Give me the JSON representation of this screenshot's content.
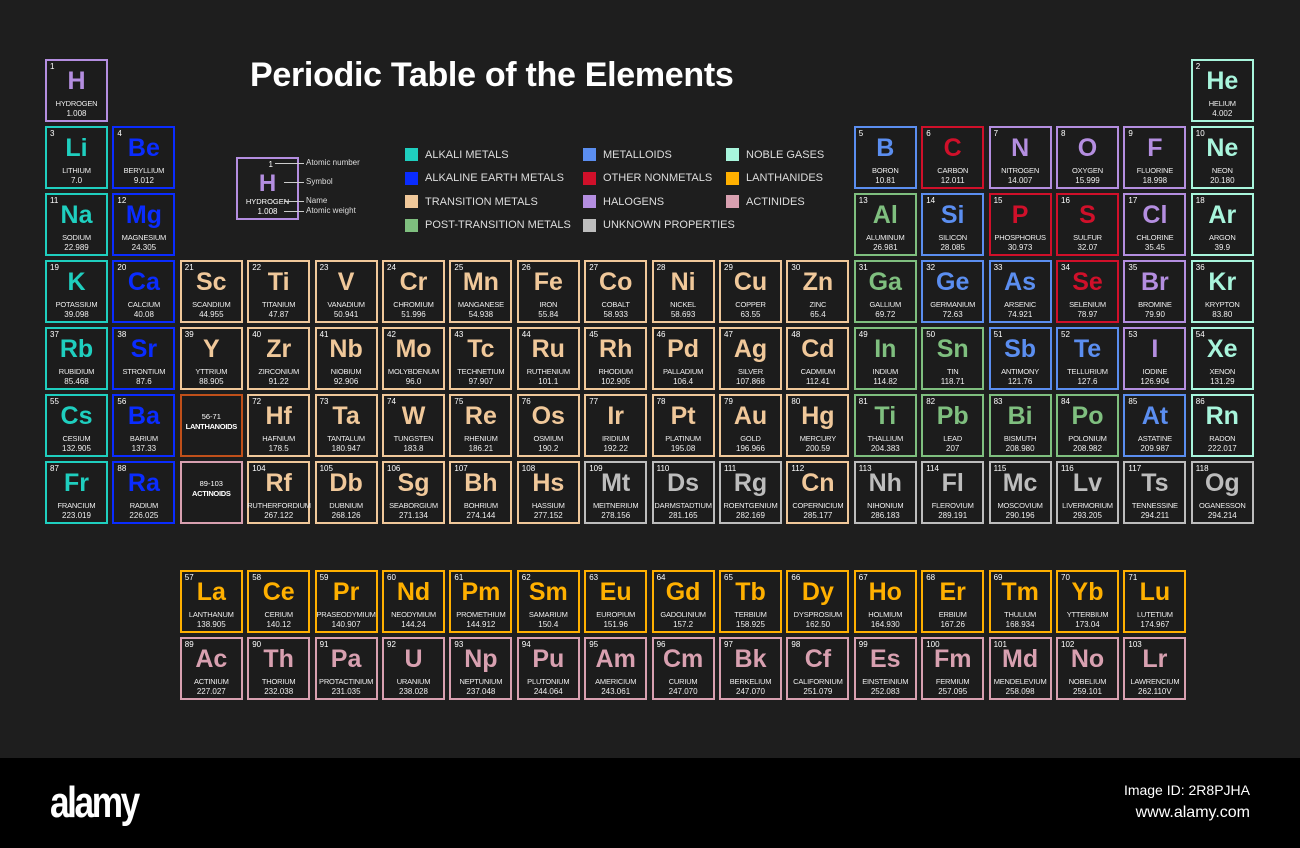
{
  "title": "Periodic Table of the Elements",
  "key": {
    "number": "1",
    "symbol": "H",
    "name": "HYDROGEN",
    "weight": "1.008",
    "labels": {
      "number": "Atomic number",
      "symbol": "Symbol",
      "name": "Name",
      "weight": "Atomic weight"
    }
  },
  "categories": {
    "alkali": {
      "label": "ALKALI METALS",
      "color": "#1fcfbf"
    },
    "alkaline": {
      "label": "ALKALINE EARTH METALS",
      "color": "#0a2cff"
    },
    "transition": {
      "label": "TRANSITION METALS",
      "color": "#f0c89a"
    },
    "post": {
      "label": "POST-TRANSITION METALS",
      "color": "#7fbf7f"
    },
    "metalloid": {
      "label": "METALLOIDS",
      "color": "#5b8ef0"
    },
    "nonmetal": {
      "label": "OTHER NONMETALS",
      "color": "#d0102a"
    },
    "halogen": {
      "label": "HALOGENS",
      "color": "#b48ee0"
    },
    "unknown": {
      "label": "UNKNOWN PROPERTIES",
      "color": "#bdbdbd"
    },
    "noble": {
      "label": "NOBLE GASES",
      "color": "#a8f5dc"
    },
    "lanthanide": {
      "label": "LANTHANIDES",
      "color": "#ffb000"
    },
    "actinide": {
      "label": "ACTINIDES",
      "color": "#d8a0b0"
    }
  },
  "legend_order": [
    "alkali",
    "alkaline",
    "transition",
    "post",
    "metalloid",
    "nonmetal",
    "halogen",
    "unknown",
    "noble",
    "lanthanide",
    "actinide"
  ],
  "placeholders": [
    {
      "range": "56-71",
      "label": "LANTHANOIDS",
      "color": "#c0501a"
    },
    {
      "range": "89-103",
      "label": "ACTINOIDS",
      "color": "#d8a0b0"
    }
  ],
  "elements": [
    [
      1,
      "H",
      "HYDROGEN",
      "1.008",
      "halogen"
    ],
    [
      2,
      "He",
      "HELIUM",
      "4.002",
      "noble"
    ],
    [
      3,
      "Li",
      "LITHIUM",
      "7.0",
      "alkali"
    ],
    [
      4,
      "Be",
      "BERYLLIUM",
      "9.012",
      "alkaline"
    ],
    [
      5,
      "B",
      "BORON",
      "10.81",
      "metalloid"
    ],
    [
      6,
      "C",
      "CARBON",
      "12.011",
      "nonmetal"
    ],
    [
      7,
      "N",
      "NITROGEN",
      "14.007",
      "halogen"
    ],
    [
      8,
      "O",
      "OXYGEN",
      "15.999",
      "halogen"
    ],
    [
      9,
      "F",
      "FLUORINE",
      "18.998",
      "halogen"
    ],
    [
      10,
      "Ne",
      "NEON",
      "20.180",
      "noble"
    ],
    [
      11,
      "Na",
      "SODIUM",
      "22.989",
      "alkali"
    ],
    [
      12,
      "Mg",
      "MAGNESIUM",
      "24.305",
      "alkaline"
    ],
    [
      13,
      "Al",
      "ALUMINUM",
      "26.981",
      "post"
    ],
    [
      14,
      "Si",
      "SILICON",
      "28.085",
      "metalloid"
    ],
    [
      15,
      "P",
      "PHOSPHORUS",
      "30.973",
      "nonmetal"
    ],
    [
      16,
      "S",
      "SULFUR",
      "32.07",
      "nonmetal"
    ],
    [
      17,
      "Cl",
      "CHLORINE",
      "35.45",
      "halogen"
    ],
    [
      18,
      "Ar",
      "ARGON",
      "39.9",
      "noble"
    ],
    [
      19,
      "K",
      "POTASSIUM",
      "39.098",
      "alkali"
    ],
    [
      20,
      "Ca",
      "CALCIUM",
      "40.08",
      "alkaline"
    ],
    [
      21,
      "Sc",
      "SCANDIUM",
      "44.955",
      "transition"
    ],
    [
      22,
      "Ti",
      "TITANIUM",
      "47.87",
      "transition"
    ],
    [
      23,
      "V",
      "VANADIUM",
      "50.941",
      "transition"
    ],
    [
      24,
      "Cr",
      "CHROMIUM",
      "51.996",
      "transition"
    ],
    [
      25,
      "Mn",
      "MANGANESE",
      "54.938",
      "transition"
    ],
    [
      26,
      "Fe",
      "IRON",
      "55.84",
      "transition"
    ],
    [
      27,
      "Co",
      "COBALT",
      "58.933",
      "transition"
    ],
    [
      28,
      "Ni",
      "NICKEL",
      "58.693",
      "transition"
    ],
    [
      29,
      "Cu",
      "COPPER",
      "63.55",
      "transition"
    ],
    [
      30,
      "Zn",
      "ZINC",
      "65.4",
      "transition"
    ],
    [
      31,
      "Ga",
      "GALLIUM",
      "69.72",
      "post"
    ],
    [
      32,
      "Ge",
      "GERMANIUM",
      "72.63",
      "metalloid"
    ],
    [
      33,
      "As",
      "ARSENIC",
      "74.921",
      "metalloid"
    ],
    [
      34,
      "Se",
      "SELENIUM",
      "78.97",
      "nonmetal"
    ],
    [
      35,
      "Br",
      "BROMINE",
      "79.90",
      "halogen"
    ],
    [
      36,
      "Kr",
      "KRYPTON",
      "83.80",
      "noble"
    ],
    [
      37,
      "Rb",
      "RUBIDIUM",
      "85.468",
      "alkali"
    ],
    [
      38,
      "Sr",
      "STRONTIUM",
      "87.6",
      "alkaline"
    ],
    [
      39,
      "Y",
      "YTTRIUM",
      "88.905",
      "transition"
    ],
    [
      40,
      "Zr",
      "ZIRCONIUM",
      "91.22",
      "transition"
    ],
    [
      41,
      "Nb",
      "NIOBIUM",
      "92.906",
      "transition"
    ],
    [
      42,
      "Mo",
      "MOLYBDENUM",
      "96.0",
      "transition"
    ],
    [
      43,
      "Tc",
      "TECHNETIUM",
      "97.907",
      "transition"
    ],
    [
      44,
      "Ru",
      "RUTHENIUM",
      "101.1",
      "transition"
    ],
    [
      45,
      "Rh",
      "RHODIUM",
      "102.905",
      "transition"
    ],
    [
      46,
      "Pd",
      "PALLADIUM",
      "106.4",
      "transition"
    ],
    [
      47,
      "Ag",
      "SILVER",
      "107.868",
      "transition"
    ],
    [
      48,
      "Cd",
      "CADMIUM",
      "112.41",
      "transition"
    ],
    [
      49,
      "In",
      "INDIUM",
      "114.82",
      "post"
    ],
    [
      50,
      "Sn",
      "TIN",
      "118.71",
      "post"
    ],
    [
      51,
      "Sb",
      "ANTIMONY",
      "121.76",
      "metalloid"
    ],
    [
      52,
      "Te",
      "TELLURIUM",
      "127.6",
      "metalloid"
    ],
    [
      53,
      "I",
      "IODINE",
      "126.904",
      "halogen"
    ],
    [
      54,
      "Xe",
      "XENON",
      "131.29",
      "noble"
    ],
    [
      55,
      "Cs",
      "CESIUM",
      "132.905",
      "alkali"
    ],
    [
      56,
      "Ba",
      "BARIUM",
      "137.33",
      "alkaline"
    ],
    [
      72,
      "Hf",
      "HAFNIUM",
      "178.5",
      "transition"
    ],
    [
      73,
      "Ta",
      "TANTALUM",
      "180.947",
      "transition"
    ],
    [
      74,
      "W",
      "TUNGSTEN",
      "183.8",
      "transition"
    ],
    [
      75,
      "Re",
      "RHENIUM",
      "186.21",
      "transition"
    ],
    [
      76,
      "Os",
      "OSMIUM",
      "190.2",
      "transition"
    ],
    [
      77,
      "Ir",
      "IRIDIUM",
      "192.22",
      "transition"
    ],
    [
      78,
      "Pt",
      "PLATINUM",
      "195.08",
      "transition"
    ],
    [
      79,
      "Au",
      "GOLD",
      "196.966",
      "transition"
    ],
    [
      80,
      "Hg",
      "MERCURY",
      "200.59",
      "transition"
    ],
    [
      81,
      "Ti",
      "THALLIUM",
      "204.383",
      "post"
    ],
    [
      82,
      "Pb",
      "LEAD",
      "207",
      "post"
    ],
    [
      83,
      "Bi",
      "BISMUTH",
      "208.980",
      "post"
    ],
    [
      84,
      "Po",
      "POLONIUM",
      "208.982",
      "post"
    ],
    [
      85,
      "At",
      "ASTATINE",
      "209.987",
      "metalloid"
    ],
    [
      86,
      "Rn",
      "RADON",
      "222.017",
      "noble"
    ],
    [
      87,
      "Fr",
      "FRANCIUM",
      "223.019",
      "alkali"
    ],
    [
      88,
      "Ra",
      "RADIUM",
      "226.025",
      "alkaline"
    ],
    [
      104,
      "Rf",
      "RUTHERFORDIUM",
      "267.122",
      "transition"
    ],
    [
      105,
      "Db",
      "DUBNIUM",
      "268.126",
      "transition"
    ],
    [
      106,
      "Sg",
      "SEABORGIUM",
      "271.134",
      "transition"
    ],
    [
      107,
      "Bh",
      "BOHRIUM",
      "274.144",
      "transition"
    ],
    [
      108,
      "Hs",
      "HASSIUM",
      "277.152",
      "transition"
    ],
    [
      109,
      "Mt",
      "MEITNERIUM",
      "278.156",
      "unknown"
    ],
    [
      110,
      "Ds",
      "DARMSTADTIUM",
      "281.165",
      "unknown"
    ],
    [
      111,
      "Rg",
      "ROENTGENIUM",
      "282.169",
      "unknown"
    ],
    [
      112,
      "Cn",
      "COPERNICIUM",
      "285.177",
      "transition"
    ],
    [
      113,
      "Nh",
      "NIHONIUM",
      "286.183",
      "unknown"
    ],
    [
      114,
      "Fl",
      "FLEROVIUM",
      "289.191",
      "unknown"
    ],
    [
      115,
      "Mc",
      "MOSCOVIUM",
      "290.196",
      "unknown"
    ],
    [
      116,
      "Lv",
      "LIVERMORIUM",
      "293.205",
      "unknown"
    ],
    [
      117,
      "Ts",
      "TENNESSINE",
      "294.211",
      "unknown"
    ],
    [
      118,
      "Og",
      "OGANESSON",
      "294.214",
      "unknown"
    ],
    [
      57,
      "La",
      "LANTHANUM",
      "138.905",
      "lanthanide"
    ],
    [
      58,
      "Ce",
      "CERIUM",
      "140.12",
      "lanthanide"
    ],
    [
      59,
      "Pr",
      "PRASEODYMIUM",
      "140.907",
      "lanthanide"
    ],
    [
      60,
      "Nd",
      "NEODYMIUM",
      "144.24",
      "lanthanide"
    ],
    [
      61,
      "Pm",
      "PROMETHIUM",
      "144.912",
      "lanthanide"
    ],
    [
      62,
      "Sm",
      "SAMARIUM",
      "150.4",
      "lanthanide"
    ],
    [
      63,
      "Eu",
      "EUROPIUM",
      "151.96",
      "lanthanide"
    ],
    [
      64,
      "Gd",
      "GADOLINIUM",
      "157.2",
      "lanthanide"
    ],
    [
      65,
      "Tb",
      "TERBIUM",
      "158.925",
      "lanthanide"
    ],
    [
      66,
      "Dy",
      "DYSPROSIUM",
      "162.50",
      "lanthanide"
    ],
    [
      67,
      "Ho",
      "HOLMIUM",
      "164.930",
      "lanthanide"
    ],
    [
      68,
      "Er",
      "ERBIUM",
      "167.26",
      "lanthanide"
    ],
    [
      69,
      "Tm",
      "THULIUM",
      "168.934",
      "lanthanide"
    ],
    [
      70,
      "Yb",
      "YTTERBIUM",
      "173.04",
      "lanthanide"
    ],
    [
      71,
      "Lu",
      "LUTETIUM",
      "174.967",
      "lanthanide"
    ],
    [
      89,
      "Ac",
      "ACTINIUM",
      "227.027",
      "actinide"
    ],
    [
      90,
      "Th",
      "THORIUM",
      "232.038",
      "actinide"
    ],
    [
      91,
      "Pa",
      "PROTACTINIUM",
      "231.035",
      "actinide"
    ],
    [
      92,
      "U",
      "URANIUM",
      "238.028",
      "actinide"
    ],
    [
      93,
      "Np",
      "NEPTUNIUM",
      "237.048",
      "actinide"
    ],
    [
      94,
      "Pu",
      "PLUTONIUM",
      "244.064",
      "actinide"
    ],
    [
      95,
      "Am",
      "AMERICIUM",
      "243.061",
      "actinide"
    ],
    [
      96,
      "Cm",
      "CURIUM",
      "247.070",
      "actinide"
    ],
    [
      97,
      "Bk",
      "BERKELIUM",
      "247.070",
      "actinide"
    ],
    [
      98,
      "Cf",
      "CALIFORNIUM",
      "251.079",
      "actinide"
    ],
    [
      99,
      "Es",
      "EINSTEINIUM",
      "252.083",
      "actinide"
    ],
    [
      100,
      "Fm",
      "FERMIUM",
      "257.095",
      "actinide"
    ],
    [
      101,
      "Md",
      "MENDELEVIUM",
      "258.098",
      "actinide"
    ],
    [
      102,
      "No",
      "NOBELIUM",
      "259.101",
      "actinide"
    ],
    [
      103,
      "Lr",
      "LAWRENCIUM",
      "262.110V",
      "actinide"
    ]
  ],
  "footer": {
    "logo": "alamy",
    "image_id": "Image ID: 2R8PJHA",
    "url": "www.alamy.com"
  }
}
